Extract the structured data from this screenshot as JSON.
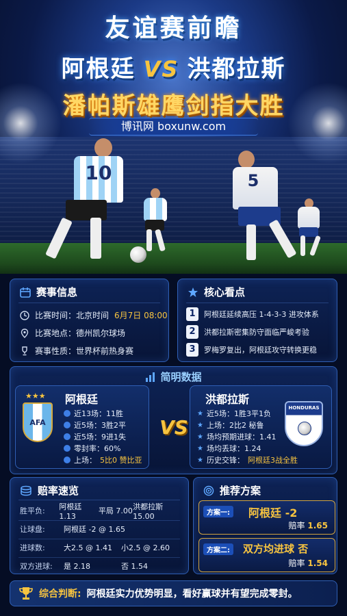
{
  "header": {
    "title": "友谊赛前瞻",
    "home": "阿根廷",
    "vs": "VS",
    "away": "洪都拉斯",
    "slogan": "潘帕斯雄鹰剑指大胜",
    "site": "博讯网 boxunw.com"
  },
  "players": {
    "left_number": "10",
    "right_number": "5",
    "badge_text": "HONDURAS"
  },
  "match_info": {
    "title": "赛事信息",
    "time_label": "比赛时间：北京时间",
    "time_value": "6月7日  08:00",
    "venue": "比赛地点：德州凯尔球场",
    "nature": "赛事性质：世界杯前热身赛"
  },
  "key_points": {
    "title": "核心看点",
    "items": [
      {
        "n": "1",
        "text": "阿根廷延续高压 1-4-3-3 进攻体系"
      },
      {
        "n": "2",
        "text": "洪都拉斯密集防守面临严峻考验"
      },
      {
        "n": "3",
        "text": "罗梅罗复出，阿根廷攻守转换更稳"
      }
    ]
  },
  "stats": {
    "title": "简明数据",
    "vs": "VS",
    "argentina": {
      "name": "阿根廷",
      "lines": [
        "近13场：11胜",
        "近5场：3胜2平",
        "近5场：9进1失",
        "零封率：60%"
      ],
      "last_label": "上场：",
      "last_value": "5比0 赞比亚"
    },
    "honduras": {
      "name": "洪都拉斯",
      "lines": [
        "近5场：1胜3平1负",
        "上场：2比2 秘鲁",
        "场均预期进球：1.41",
        "场均丢球：1.24"
      ],
      "history_label": "历史交锋：",
      "history_value": "阿根廷3战全胜"
    }
  },
  "odds": {
    "title": "赔率速览",
    "rows": [
      {
        "label": "胜平负:",
        "a": "阿根廷 1.13",
        "b": "平局 7.00",
        "c": "洪都拉斯 15.00"
      },
      {
        "label": "让球盘:",
        "a": "阿根廷  -2 @ 1.65",
        "b": "",
        "c": ""
      },
      {
        "label": "进球数:",
        "a": "大2.5 @ 1.41",
        "b": "小2.5 @ 2.60",
        "c": ""
      },
      {
        "label": "双方进球:",
        "a": "是  2.18",
        "b": "否  1.54",
        "c": ""
      }
    ],
    "highlight_color": "#f7c440"
  },
  "recommend": {
    "title": "推荐方案",
    "plans": [
      {
        "tag": "方案一:",
        "pick": "阿根廷 -2",
        "odds_label": "赔率",
        "odds": "1.65"
      },
      {
        "tag": "方案二:",
        "pick": "双方均进球 否",
        "odds_label": "赔率",
        "odds": "1.54"
      }
    ]
  },
  "conclusion": {
    "label": "综合判断:",
    "text": "阿根廷实力优势明显，看好赢球并有望完成零封。"
  },
  "colors": {
    "accent_gold": "#f7c440",
    "panel_border": "#2f5fb5",
    "background": "#050d24"
  }
}
